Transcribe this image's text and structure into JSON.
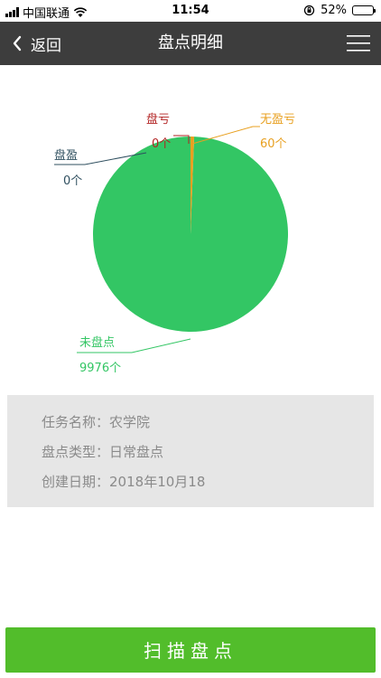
{
  "status_bar": {
    "carrier": "中国联通",
    "time": "11:54",
    "battery_percent": "52%",
    "battery_level": 0.52,
    "icons": [
      "signal-icon",
      "wifi-icon",
      "orientation-lock-icon",
      "battery-icon"
    ]
  },
  "nav": {
    "back_label": "返回",
    "title": "盘点明细",
    "icons": [
      "chevron-left-icon",
      "menu-icon"
    ]
  },
  "chart_data": {
    "type": "pie",
    "slices": [
      {
        "label": "未盘点",
        "value": 9976,
        "value_label": "9976个",
        "color": "#33c664"
      },
      {
        "label": "盘盈",
        "value": 0,
        "value_label": "0个",
        "color": "#2f4f5f"
      },
      {
        "label": "盘亏",
        "value": 0,
        "value_label": "0个",
        "color": "#b22222"
      },
      {
        "label": "无盈亏",
        "value": 60,
        "value_label": "60个",
        "color": "#e8a020"
      }
    ]
  },
  "info": {
    "task_name_label": "任务名称：",
    "task_name": "农学院",
    "type_label": "盘点类型：",
    "type": "日常盘点",
    "date_label": "创建日期：",
    "date": "2018年10月18"
  },
  "scan_button_label": "扫描盘点",
  "colors": {
    "nav_background": "#3d3d3d",
    "button_green": "#52bd2b",
    "panel_gray": "#e6e6e6"
  }
}
